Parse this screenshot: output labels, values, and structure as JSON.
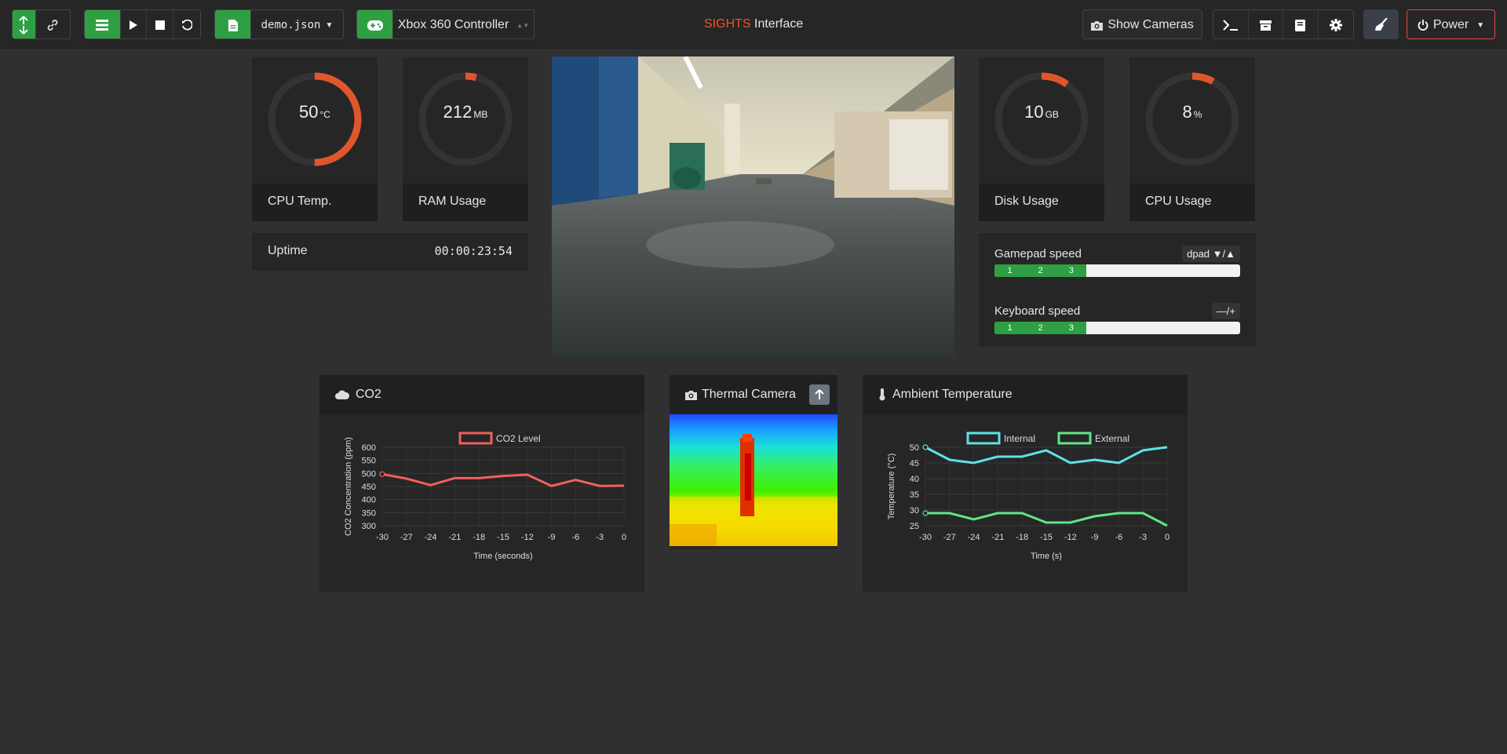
{
  "navbar": {
    "brand_accent": "SIGHTS",
    "brand_rest": " Interface",
    "config_file": "demo.json",
    "controller": "Xbox 360 Controller",
    "show_cameras": "Show Cameras",
    "power": "Power"
  },
  "gauges": {
    "cpu_temp": {
      "value": "50",
      "unit": "°C",
      "label": "CPU Temp.",
      "fraction": 0.5
    },
    "ram": {
      "value": "212",
      "unit": "MB",
      "label": "RAM Usage",
      "fraction": 0.04
    },
    "disk": {
      "value": "10",
      "unit": "GB",
      "label": "Disk Usage",
      "fraction": 0.1
    },
    "cpu_usage": {
      "value": "8",
      "unit": "%",
      "label": "CPU Usage",
      "fraction": 0.08
    }
  },
  "uptime": {
    "label": "Uptime",
    "value": "00:00:23:54"
  },
  "speed": {
    "gamepad_label": "Gamepad speed",
    "gamepad_ctrl": "dpad ▼/▲",
    "keyboard_label": "Keyboard speed",
    "keyboard_ctrl": "—/+",
    "segments": [
      "1",
      "2",
      "3"
    ],
    "level_fraction": 0.375
  },
  "panels": {
    "co2_title": "CO2",
    "thermal_title": "Thermal Camera",
    "ambient_title": "Ambient Temperature"
  },
  "colors": {
    "accent": "#f2541f",
    "green": "#2ea043",
    "gauge": "#e0562c",
    "co2": "#f06060",
    "internal": "#5ee1e6",
    "external": "#5ee68a"
  },
  "chart_data": [
    {
      "type": "line",
      "legend": [
        "CO2 Level"
      ],
      "xlabel": "Time (seconds)",
      "ylabel": "CO2 Concentration (ppm)",
      "x": [
        -30,
        -27,
        -24,
        -21,
        -18,
        -15,
        -12,
        -9,
        -6,
        -3,
        0
      ],
      "ylim": [
        300,
        600
      ],
      "yticks": [
        300,
        350,
        400,
        450,
        500,
        550,
        600
      ],
      "series": [
        {
          "name": "CO2 Level",
          "values": [
            497,
            480,
            455,
            482,
            482,
            490,
            495,
            452,
            475,
            452,
            453
          ]
        }
      ]
    },
    {
      "type": "line",
      "legend": [
        "Internal",
        "External"
      ],
      "xlabel": "Time (s)",
      "ylabel": "Temperature (°C)",
      "x": [
        -30,
        -27,
        -24,
        -21,
        -18,
        -15,
        -12,
        -9,
        -6,
        -3,
        0
      ],
      "ylim": [
        25,
        50
      ],
      "yticks": [
        25,
        30,
        35,
        40,
        45,
        50
      ],
      "series": [
        {
          "name": "Internal",
          "values": [
            50,
            46,
            45,
            47,
            47,
            49,
            45,
            46,
            45,
            49,
            50
          ]
        },
        {
          "name": "External",
          "values": [
            29,
            29,
            27,
            29,
            29,
            26,
            26,
            28,
            29,
            29,
            25
          ]
        }
      ]
    }
  ]
}
